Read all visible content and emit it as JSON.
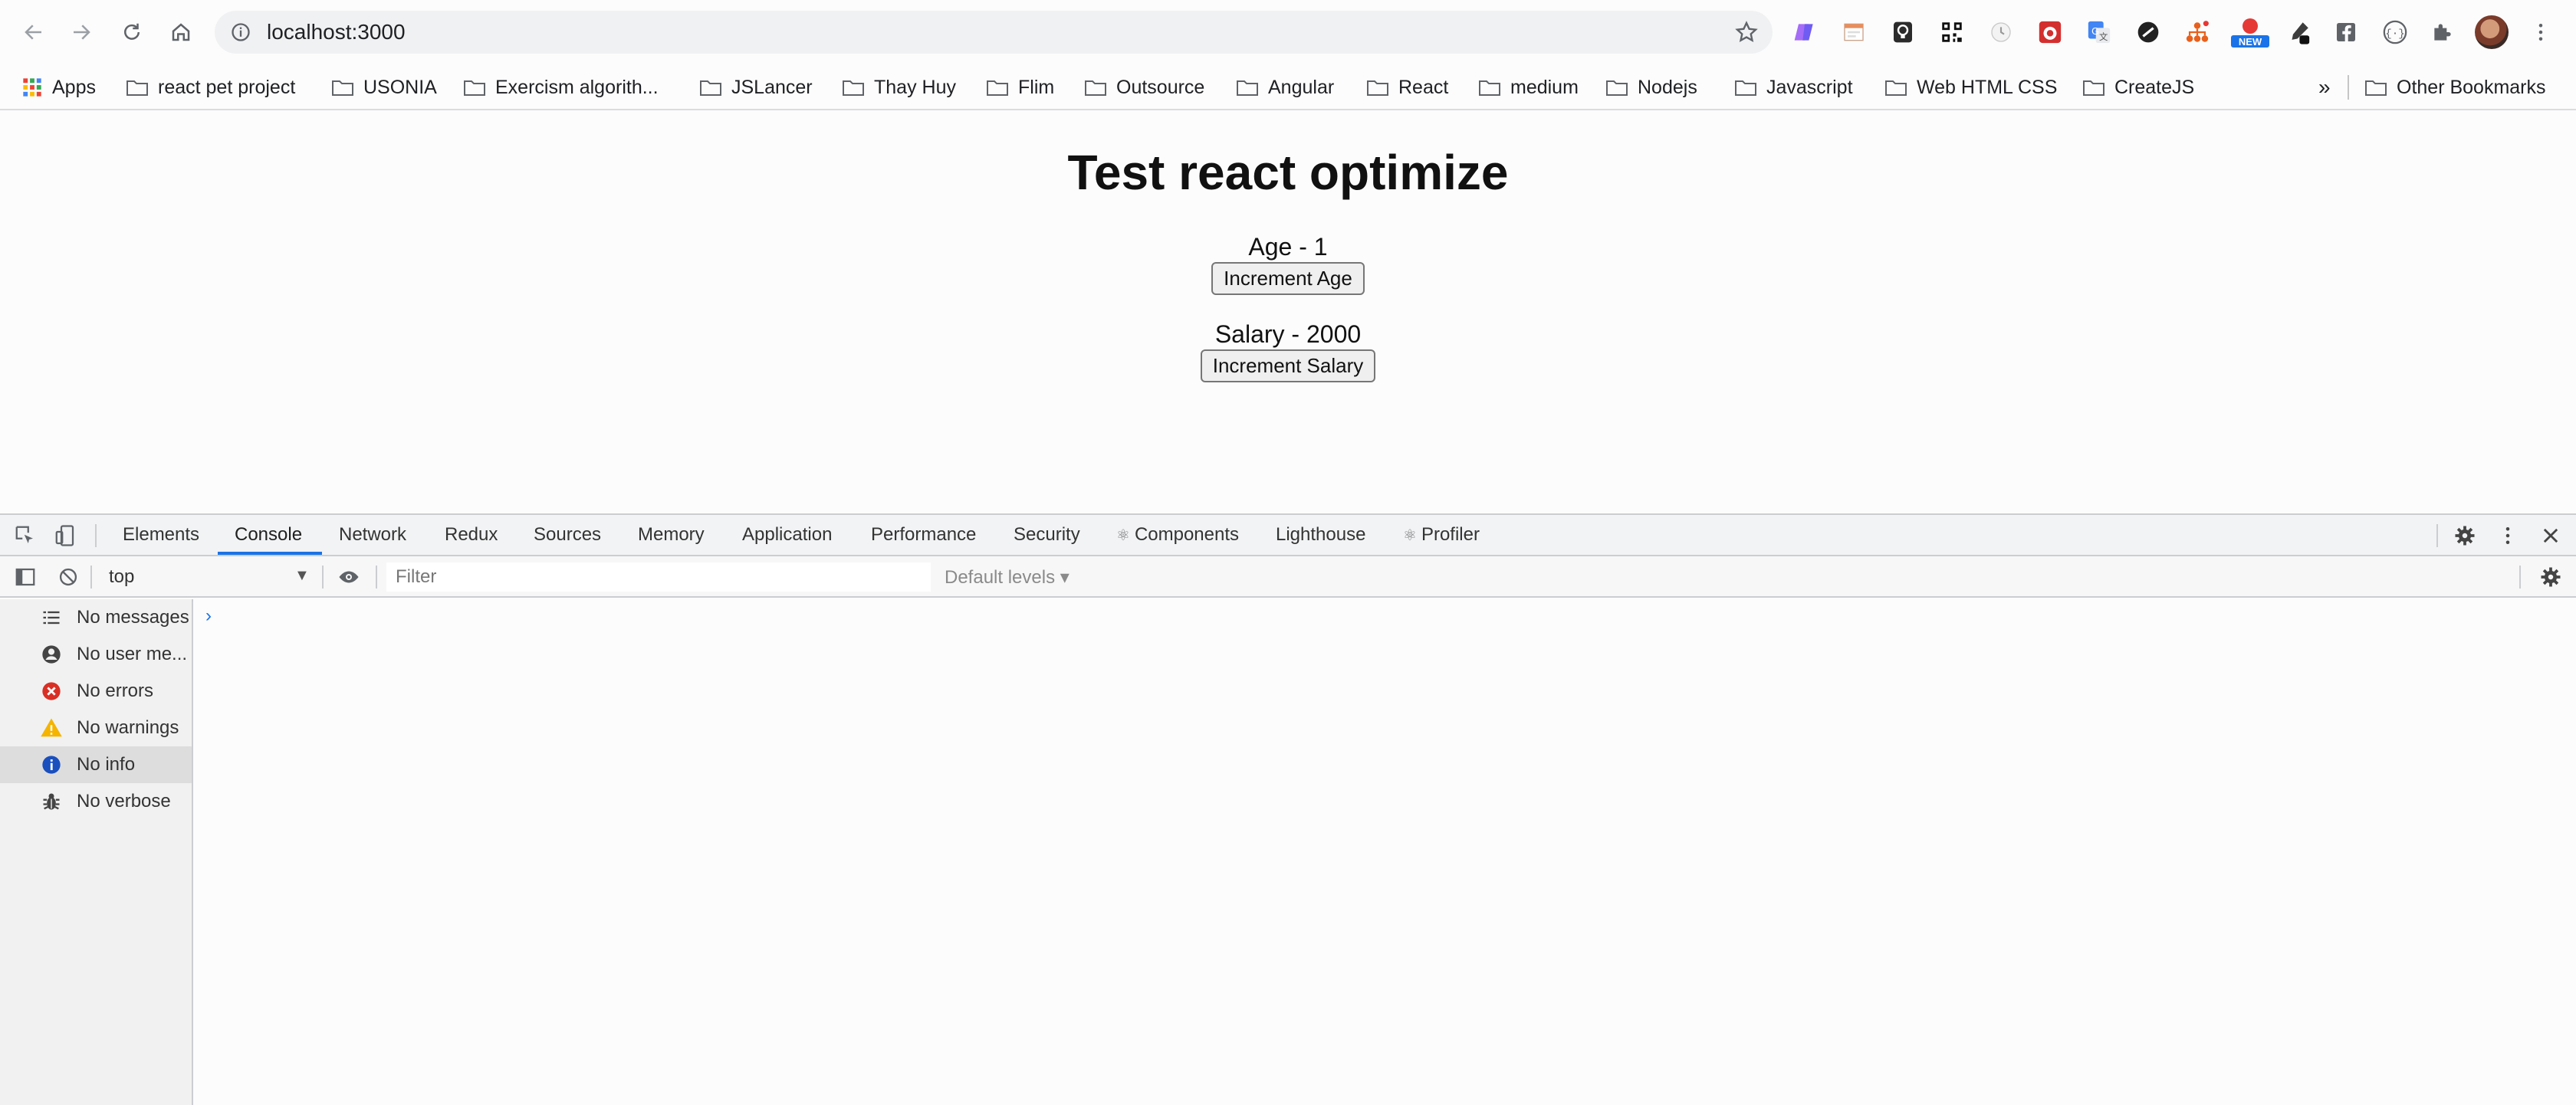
{
  "browser": {
    "url": "localhost:3000",
    "extensions": [
      "paint-icon",
      "calendar-icon",
      "bulb-icon",
      "qr-icon",
      "clock-icon",
      "ladybug-icon",
      "translate-icon",
      "vpn-icon",
      "network-icon",
      "new-badge-icon",
      "dropper-icon",
      "facebook-icon",
      "bracket-icon",
      "puzzle-icon"
    ],
    "new_badge": "NEW"
  },
  "bookmarks": {
    "apps_label": "Apps",
    "items": [
      "react pet project",
      "USONIA",
      "Exercism algorith...",
      "JSLancer",
      "Thay Huy",
      "Flim",
      "Outsource",
      "Angular",
      "React",
      "medium",
      "Nodejs",
      "Javascript",
      "Web HTML CSS",
      "CreateJS"
    ],
    "overflow": "»",
    "other": "Other Bookmarks"
  },
  "page": {
    "title": "Test react optimize",
    "age_text": "Age - 1",
    "age_button": "Increment Age",
    "salary_text": "Salary - 2000",
    "salary_button": "Increment Salary"
  },
  "devtools": {
    "tabs": [
      "Elements",
      "Console",
      "Network",
      "Redux",
      "Sources",
      "Memory",
      "Application",
      "Performance",
      "Security",
      "Components",
      "Lighthouse",
      "Profiler"
    ],
    "active_tab": "Console",
    "context": "top",
    "filter_placeholder": "Filter",
    "levels": "Default levels ▾",
    "sidebar": [
      {
        "label": "No messages",
        "icon": "list-icon"
      },
      {
        "label": "No user me...",
        "icon": "user-icon"
      },
      {
        "label": "No errors",
        "icon": "error-icon"
      },
      {
        "label": "No warnings",
        "icon": "warning-icon"
      },
      {
        "label": "No info",
        "icon": "info-icon"
      },
      {
        "label": "No verbose",
        "icon": "bug-icon"
      }
    ],
    "selected_sidebar": "No info",
    "prompt": "›",
    "colors": {
      "accent": "#1a73e8",
      "error": "#d93025",
      "warning": "#f4b400",
      "info": "#1a73e8"
    }
  }
}
